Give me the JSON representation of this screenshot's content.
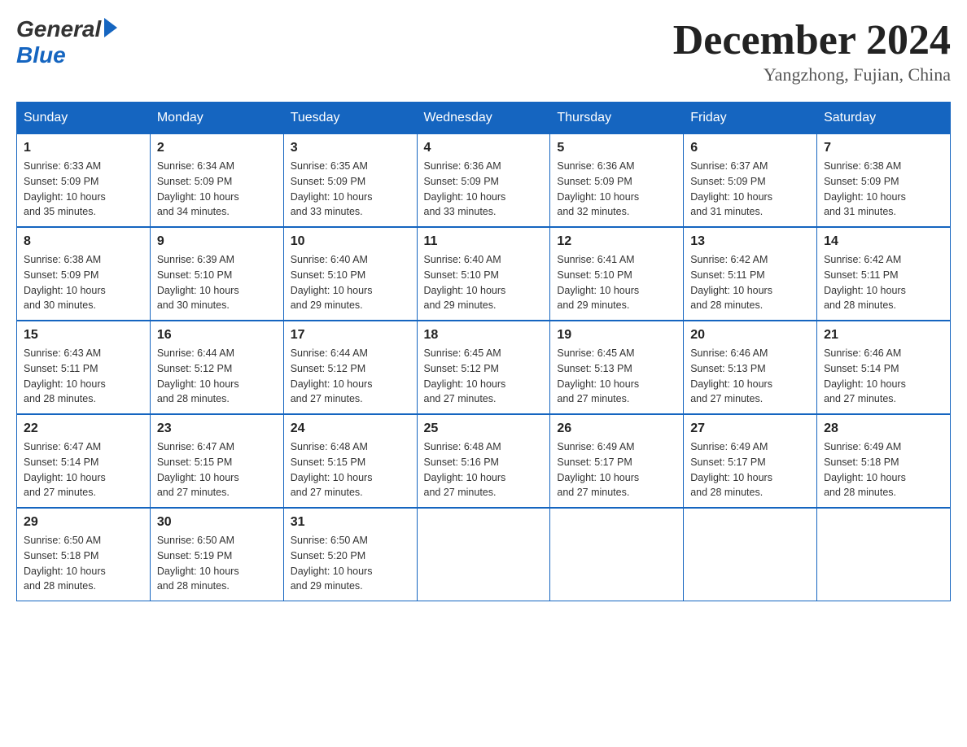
{
  "logo": {
    "general": "General",
    "blue": "Blue"
  },
  "header": {
    "month": "December 2024",
    "location": "Yangzhong, Fujian, China"
  },
  "weekdays": [
    "Sunday",
    "Monday",
    "Tuesday",
    "Wednesday",
    "Thursday",
    "Friday",
    "Saturday"
  ],
  "weeks": [
    [
      {
        "day": 1,
        "sunrise": "6:33 AM",
        "sunset": "5:09 PM",
        "daylight": "10 hours and 35 minutes."
      },
      {
        "day": 2,
        "sunrise": "6:34 AM",
        "sunset": "5:09 PM",
        "daylight": "10 hours and 34 minutes."
      },
      {
        "day": 3,
        "sunrise": "6:35 AM",
        "sunset": "5:09 PM",
        "daylight": "10 hours and 33 minutes."
      },
      {
        "day": 4,
        "sunrise": "6:36 AM",
        "sunset": "5:09 PM",
        "daylight": "10 hours and 33 minutes."
      },
      {
        "day": 5,
        "sunrise": "6:36 AM",
        "sunset": "5:09 PM",
        "daylight": "10 hours and 32 minutes."
      },
      {
        "day": 6,
        "sunrise": "6:37 AM",
        "sunset": "5:09 PM",
        "daylight": "10 hours and 31 minutes."
      },
      {
        "day": 7,
        "sunrise": "6:38 AM",
        "sunset": "5:09 PM",
        "daylight": "10 hours and 31 minutes."
      }
    ],
    [
      {
        "day": 8,
        "sunrise": "6:38 AM",
        "sunset": "5:09 PM",
        "daylight": "10 hours and 30 minutes."
      },
      {
        "day": 9,
        "sunrise": "6:39 AM",
        "sunset": "5:10 PM",
        "daylight": "10 hours and 30 minutes."
      },
      {
        "day": 10,
        "sunrise": "6:40 AM",
        "sunset": "5:10 PM",
        "daylight": "10 hours and 29 minutes."
      },
      {
        "day": 11,
        "sunrise": "6:40 AM",
        "sunset": "5:10 PM",
        "daylight": "10 hours and 29 minutes."
      },
      {
        "day": 12,
        "sunrise": "6:41 AM",
        "sunset": "5:10 PM",
        "daylight": "10 hours and 29 minutes."
      },
      {
        "day": 13,
        "sunrise": "6:42 AM",
        "sunset": "5:11 PM",
        "daylight": "10 hours and 28 minutes."
      },
      {
        "day": 14,
        "sunrise": "6:42 AM",
        "sunset": "5:11 PM",
        "daylight": "10 hours and 28 minutes."
      }
    ],
    [
      {
        "day": 15,
        "sunrise": "6:43 AM",
        "sunset": "5:11 PM",
        "daylight": "10 hours and 28 minutes."
      },
      {
        "day": 16,
        "sunrise": "6:44 AM",
        "sunset": "5:12 PM",
        "daylight": "10 hours and 28 minutes."
      },
      {
        "day": 17,
        "sunrise": "6:44 AM",
        "sunset": "5:12 PM",
        "daylight": "10 hours and 27 minutes."
      },
      {
        "day": 18,
        "sunrise": "6:45 AM",
        "sunset": "5:12 PM",
        "daylight": "10 hours and 27 minutes."
      },
      {
        "day": 19,
        "sunrise": "6:45 AM",
        "sunset": "5:13 PM",
        "daylight": "10 hours and 27 minutes."
      },
      {
        "day": 20,
        "sunrise": "6:46 AM",
        "sunset": "5:13 PM",
        "daylight": "10 hours and 27 minutes."
      },
      {
        "day": 21,
        "sunrise": "6:46 AM",
        "sunset": "5:14 PM",
        "daylight": "10 hours and 27 minutes."
      }
    ],
    [
      {
        "day": 22,
        "sunrise": "6:47 AM",
        "sunset": "5:14 PM",
        "daylight": "10 hours and 27 minutes."
      },
      {
        "day": 23,
        "sunrise": "6:47 AM",
        "sunset": "5:15 PM",
        "daylight": "10 hours and 27 minutes."
      },
      {
        "day": 24,
        "sunrise": "6:48 AM",
        "sunset": "5:15 PM",
        "daylight": "10 hours and 27 minutes."
      },
      {
        "day": 25,
        "sunrise": "6:48 AM",
        "sunset": "5:16 PM",
        "daylight": "10 hours and 27 minutes."
      },
      {
        "day": 26,
        "sunrise": "6:49 AM",
        "sunset": "5:17 PM",
        "daylight": "10 hours and 27 minutes."
      },
      {
        "day": 27,
        "sunrise": "6:49 AM",
        "sunset": "5:17 PM",
        "daylight": "10 hours and 28 minutes."
      },
      {
        "day": 28,
        "sunrise": "6:49 AM",
        "sunset": "5:18 PM",
        "daylight": "10 hours and 28 minutes."
      }
    ],
    [
      {
        "day": 29,
        "sunrise": "6:50 AM",
        "sunset": "5:18 PM",
        "daylight": "10 hours and 28 minutes."
      },
      {
        "day": 30,
        "sunrise": "6:50 AM",
        "sunset": "5:19 PM",
        "daylight": "10 hours and 28 minutes."
      },
      {
        "day": 31,
        "sunrise": "6:50 AM",
        "sunset": "5:20 PM",
        "daylight": "10 hours and 29 minutes."
      },
      null,
      null,
      null,
      null
    ]
  ],
  "labels": {
    "sunrise": "Sunrise:",
    "sunset": "Sunset:",
    "daylight": "Daylight:"
  }
}
